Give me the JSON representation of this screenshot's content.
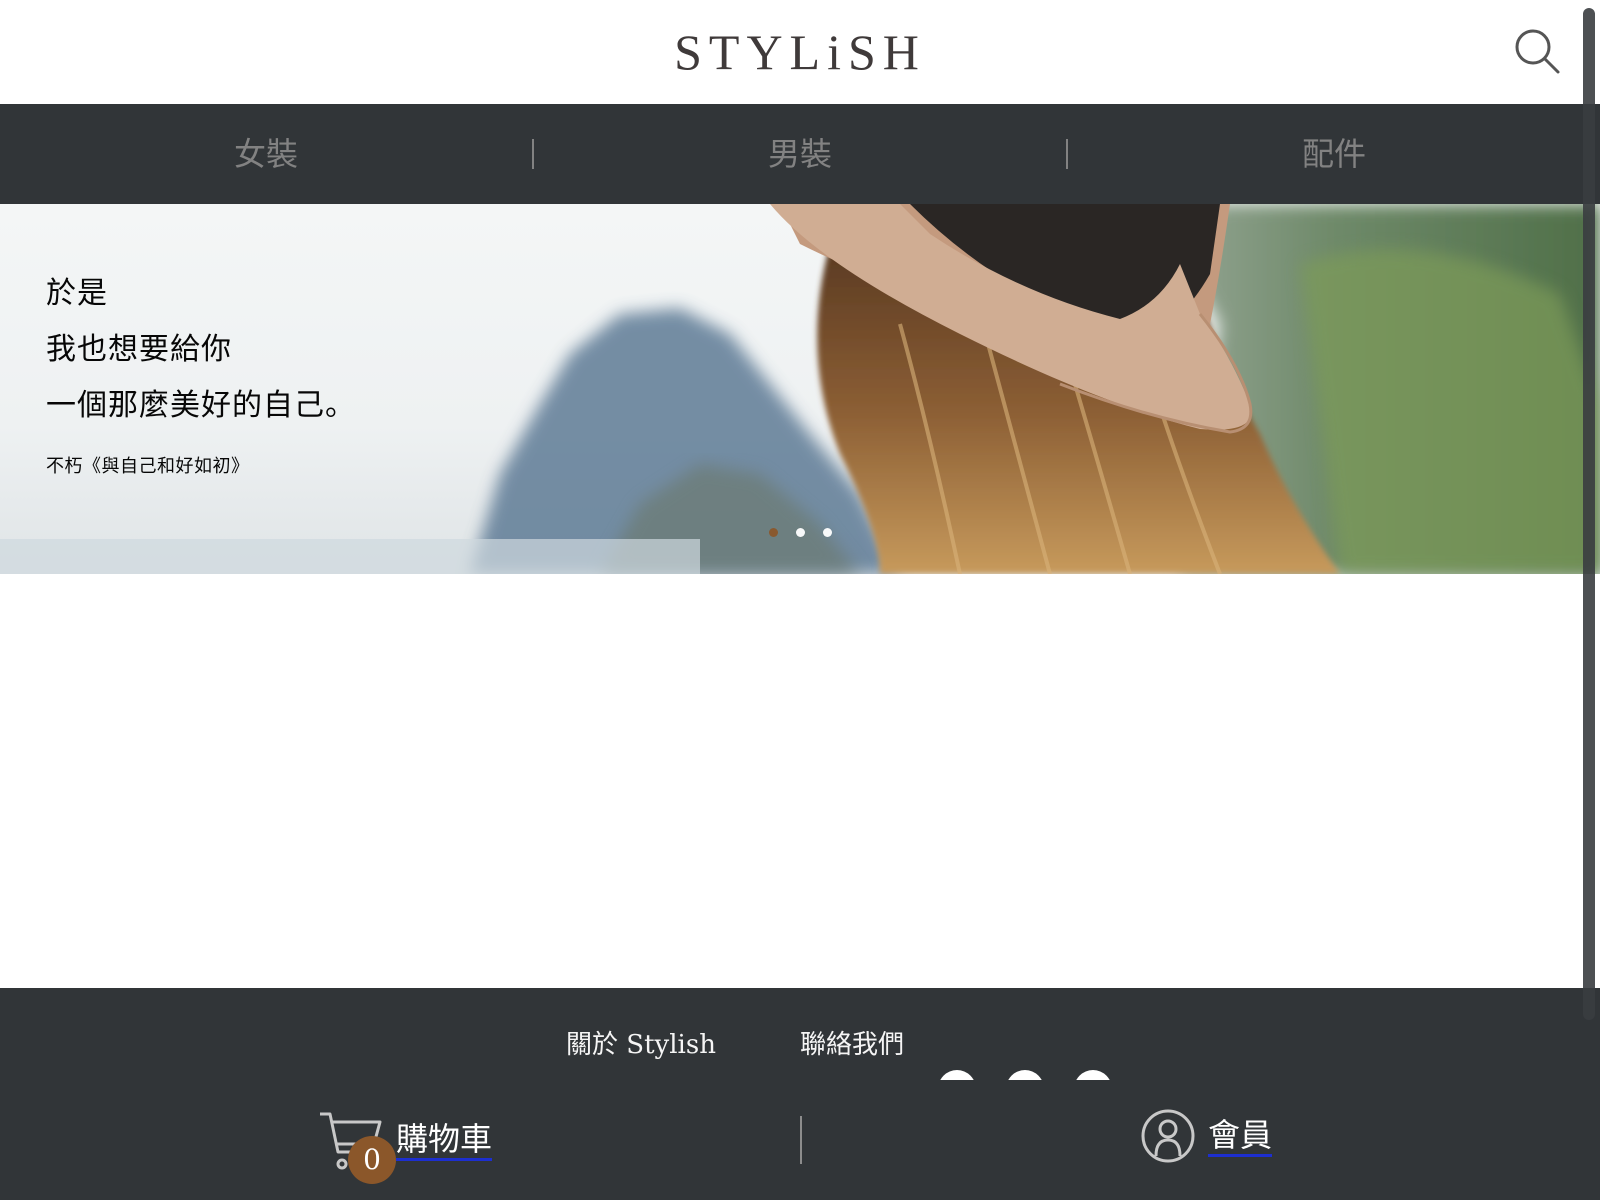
{
  "header": {
    "logo_text": "STYLiSH",
    "search_icon": "search-icon"
  },
  "nav": {
    "items": [
      {
        "label": "女裝"
      },
      {
        "label": "男裝"
      },
      {
        "label": "配件"
      }
    ]
  },
  "hero": {
    "lines": [
      "於是",
      "我也想要給你",
      "一個那麼美好的自己。"
    ],
    "source": "不朽《與自己和好如初》",
    "slides": {
      "count": 3,
      "active_index": 0
    }
  },
  "footer": {
    "links": [
      "關於 Stylish",
      "聯絡我們"
    ],
    "social_icons": [
      "line-icon",
      "twitter-icon",
      "facebook-icon"
    ]
  },
  "bottom_bar": {
    "cart": {
      "label": "購物車",
      "count": "0",
      "icon": "cart-icon"
    },
    "member": {
      "label": "會員",
      "icon": "member-icon"
    }
  },
  "colors": {
    "nav_bg": "#313538",
    "nav_text": "#828282",
    "accent": "#8b572a",
    "logo": "#3f3a3a",
    "footer_text": "#f5f5f5"
  }
}
